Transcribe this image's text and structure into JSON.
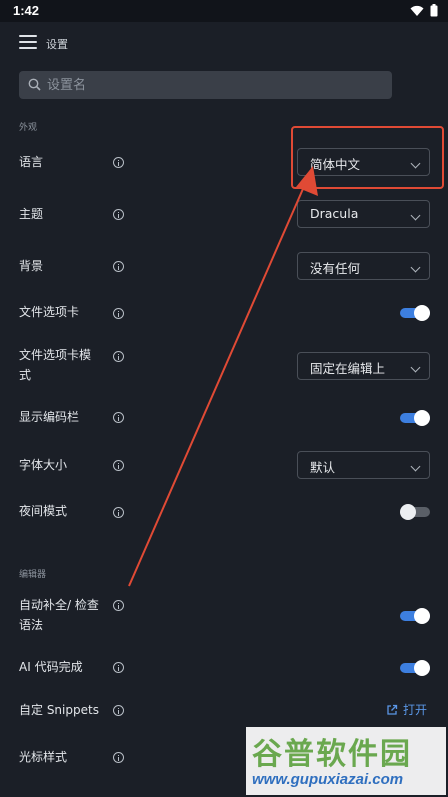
{
  "status_bar": {
    "time": "1:42"
  },
  "header": {
    "title": "设置"
  },
  "search": {
    "placeholder": "设置名"
  },
  "sections": {
    "appearance": "外观",
    "editor": "编辑器"
  },
  "settings": {
    "language": {
      "label": "语言",
      "value": "简体中文"
    },
    "theme": {
      "label": "主题",
      "value": "Dracula"
    },
    "background": {
      "label": "背景",
      "value": "没有任何"
    },
    "file_tabs": {
      "label": "文件选项卡",
      "enabled": true
    },
    "file_tabs_mode": {
      "label_line1": "文件选项卡模",
      "label_line2": "式",
      "value": "固定在编辑上"
    },
    "show_toolbar": {
      "label": "显示编码栏",
      "enabled": true
    },
    "font_size": {
      "label": "字体大小",
      "value": "默认"
    },
    "night_mode": {
      "label": "夜间模式",
      "enabled": false
    },
    "autocomplete": {
      "label_line1": "自动补全/ 检查",
      "label_line2": "语法",
      "enabled": true
    },
    "ai_completion": {
      "label": "AI 代码完成",
      "enabled": true
    },
    "custom_snippets": {
      "label": "自定 Snippets",
      "action": "打开"
    },
    "cursor_style": {
      "label": "光标样式"
    }
  },
  "colors": {
    "background": "#1b1f27",
    "accent": "#3d7fe0",
    "link": "#5a96e6",
    "annotation": "#e04a35"
  },
  "watermark": {
    "title": "谷普软件园",
    "url": "www.gupuxiazai.com"
  }
}
